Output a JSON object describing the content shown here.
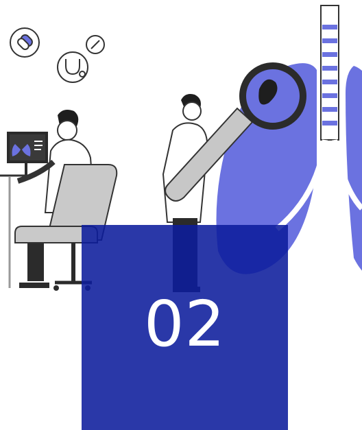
{
  "illustration": {
    "subject": "medical-lungs-illustration",
    "accent_color": "#6b72e0",
    "outline_color": "#2b2b2b",
    "glass_color": "#c7c7c7"
  },
  "badge": {
    "number": "02",
    "background_color": "#0d1d9c"
  }
}
